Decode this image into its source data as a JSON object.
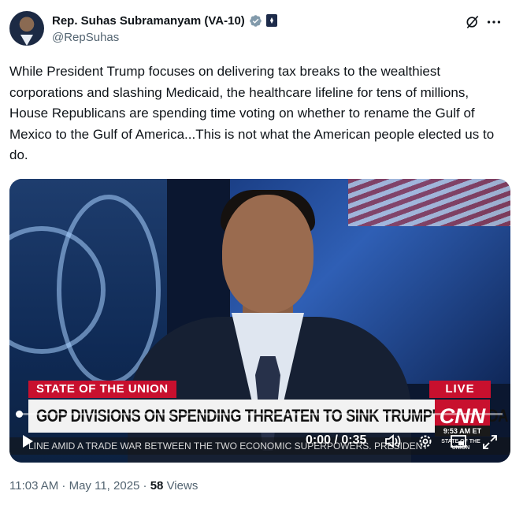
{
  "author": {
    "name": "Rep. Suhas Subramanyam (VA-10)",
    "handle": "@RepSuhas"
  },
  "header_icons": [
    "grok-icon",
    "more-icon"
  ],
  "tweet": {
    "text": "While President Trump focuses on delivering tax breaks to the wealthiest corporations and slashing Medicaid, the healthcare lifeline for tens of millions, House Republicans are spending time voting on whether to rename the Gulf of Mexico to the Gulf of America...This is not what the American people elected us to do."
  },
  "video": {
    "show_tag": "STATE OF THE UNION",
    "live_label": "LIVE",
    "headline": "GOP DIVISIONS ON SPENDING THREATEN TO SINK TRUMP'S AGENDA",
    "network_logo": "CNN",
    "clock": "9:53 AM ET",
    "ticker": "LINE AMID A TRADE WAR BETWEEN THE TWO ECONOMIC SUPERPOWERS. PRESIDENT",
    "mini_logo": "STATE OF THE UNION",
    "timecode": "0:00 / 0:35",
    "progress": 0
  },
  "footer": {
    "time_date": "11:03 AM · May 11, 2025 · ",
    "views_count": "58",
    "views_label": " Views"
  },
  "colors": {
    "verified": "#829aab",
    "cnn_red": "#c8102e",
    "text": "#0f1419",
    "muted": "#536471"
  }
}
